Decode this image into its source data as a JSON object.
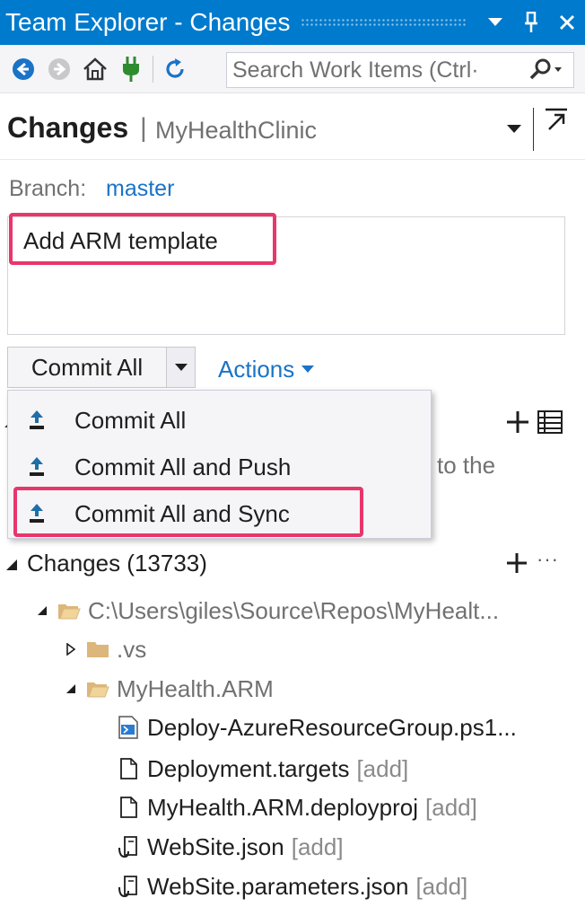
{
  "window": {
    "title": "Team Explorer - Changes",
    "buttons": [
      "dropdown",
      "pin",
      "close"
    ]
  },
  "toolbar": {
    "icons": [
      "back-icon",
      "forward-icon",
      "home-icon",
      "connect-icon",
      "refresh-icon"
    ],
    "search_placeholder": "Search Work Items (Ctrl·"
  },
  "header": {
    "title": "Changes",
    "separator": "|",
    "repo": "MyHealthClinic"
  },
  "branch": {
    "label": "Branch:",
    "name": "master"
  },
  "commit_message": "Add ARM template",
  "commit_button": {
    "label": "Commit All",
    "actions_label": "Actions"
  },
  "dropdown_menu": {
    "items": [
      {
        "label": "Commit All"
      },
      {
        "label": "Commit All and Push"
      },
      {
        "label": "Commit All and Sync"
      }
    ]
  },
  "underlying_text": "to the",
  "changes": {
    "title": "Changes (13733)",
    "more": "···",
    "tree": [
      {
        "label": "C:\\Users\\giles\\Source\\Repos\\MyHealt...",
        "type": "folder",
        "expanded": true,
        "level": 0
      },
      {
        "label": ".vs",
        "type": "folder",
        "expanded": false,
        "level": 1
      },
      {
        "label": "MyHealth.ARM",
        "type": "folder",
        "expanded": true,
        "level": 1
      },
      {
        "label": "Deploy-AzureResourceGroup.ps1...",
        "type": "ps1",
        "tag": "",
        "level": 2
      },
      {
        "label": "Deployment.targets",
        "type": "file",
        "tag": "[add]",
        "level": 2
      },
      {
        "label": "MyHealth.ARM.deployproj",
        "type": "file",
        "tag": "[add]",
        "level": 2
      },
      {
        "label": "WebSite.json",
        "type": "json",
        "tag": "[add]",
        "level": 2
      },
      {
        "label": "WebSite.parameters.json",
        "type": "json",
        "tag": "[add]",
        "level": 2
      }
    ]
  },
  "colors": {
    "accent": "#007acc",
    "link": "#1a73c7",
    "highlight": "#e8366b",
    "folder": "#dcb67a"
  }
}
